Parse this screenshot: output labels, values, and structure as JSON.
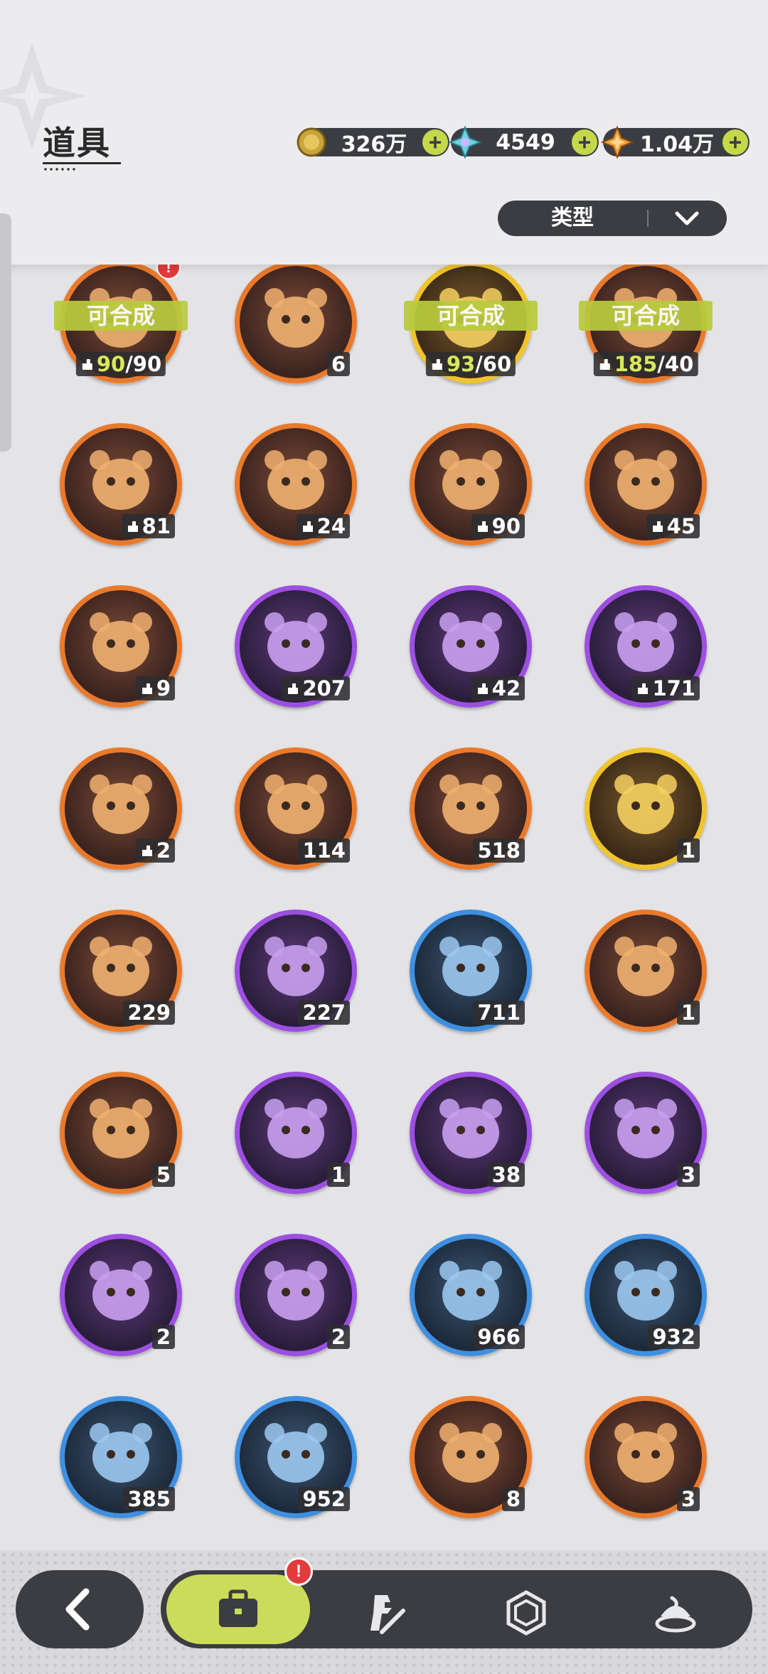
{
  "header": {
    "title": "道具",
    "filter": {
      "label": "类型"
    }
  },
  "currencies": [
    {
      "icon": "gold-coin-icon",
      "amount": "326万"
    },
    {
      "icon": "crystal-gem-icon",
      "amount": "4549"
    },
    {
      "icon": "star-shard-icon",
      "amount": "1.04万"
    }
  ],
  "craftable_label": "可合成",
  "items": [
    {
      "icon": "bear-doll-icon",
      "rarity": "orange",
      "type": "shard",
      "have": "90",
      "need": "/90",
      "craftable": true,
      "alert": "!"
    },
    {
      "icon": "purple-crystal-icon",
      "rarity": "orange",
      "type": "count",
      "count": "6"
    },
    {
      "icon": "bear-doll-icon",
      "rarity": "gold",
      "type": "shard",
      "have": "93",
      "need": "/60",
      "craftable": true
    },
    {
      "icon": "bear-doll-icon",
      "rarity": "orange",
      "type": "shard",
      "have": "185",
      "need": "/40",
      "craftable": true
    },
    {
      "icon": "brown-bear-icon",
      "rarity": "orange",
      "type": "shard",
      "count": "81"
    },
    {
      "icon": "knight-bear-icon",
      "rarity": "orange",
      "type": "shard",
      "count": "24"
    },
    {
      "icon": "white-bear-icon",
      "rarity": "orange",
      "type": "shard",
      "count": "90"
    },
    {
      "icon": "dark-bear-icon",
      "rarity": "orange",
      "type": "shard",
      "count": "45"
    },
    {
      "icon": "lavender-cat-icon",
      "rarity": "orange",
      "type": "shard",
      "count": "9"
    },
    {
      "icon": "green-frog-icon",
      "rarity": "purple",
      "type": "shard",
      "count": "207"
    },
    {
      "icon": "brown-pirate-bear-icon",
      "rarity": "purple",
      "type": "shard",
      "count": "42"
    },
    {
      "icon": "yellow-bird-icon",
      "rarity": "purple",
      "type": "shard",
      "count": "171"
    },
    {
      "icon": "tiger-cat-icon",
      "rarity": "orange",
      "type": "shard",
      "count": "2"
    },
    {
      "icon": "pink-star-crystal-icon",
      "rarity": "orange",
      "type": "count",
      "count": "114"
    },
    {
      "icon": "blue-star-crystal-icon",
      "rarity": "orange",
      "type": "count",
      "count": "518"
    },
    {
      "icon": "golden-card-icon",
      "rarity": "gold",
      "type": "count",
      "count": "1"
    },
    {
      "icon": "gold-character-card-icon",
      "rarity": "orange",
      "type": "count",
      "count": "229"
    },
    {
      "icon": "purple-character-card-icon",
      "rarity": "purple",
      "type": "count",
      "count": "227"
    },
    {
      "icon": "blue-character-card-icon",
      "rarity": "blue",
      "type": "count",
      "count": "711"
    },
    {
      "icon": "mystic-card-icon",
      "rarity": "orange",
      "type": "count",
      "count": "1"
    },
    {
      "icon": "clover-ticket-icon",
      "rarity": "orange",
      "type": "count",
      "count": "5"
    },
    {
      "icon": "chocolate-gift-icon",
      "rarity": "purple",
      "type": "count",
      "count": "1"
    },
    {
      "icon": "golden-bag-icon",
      "rarity": "purple",
      "type": "count",
      "count": "38"
    },
    {
      "icon": "magic-mirror-icon",
      "rarity": "purple",
      "type": "count",
      "count": "3"
    },
    {
      "icon": "scroll-icon",
      "rarity": "purple",
      "type": "count",
      "count": "2"
    },
    {
      "icon": "pink-apple-icon",
      "rarity": "purple",
      "type": "count",
      "count": "2"
    },
    {
      "icon": "shovel-icon",
      "rarity": "blue",
      "type": "count",
      "count": "966"
    },
    {
      "icon": "gauntlet-icon",
      "rarity": "blue",
      "type": "count",
      "count": "932"
    },
    {
      "icon": "pickaxe-icon",
      "rarity": "blue",
      "type": "count",
      "count": "385"
    },
    {
      "icon": "hammer-icon",
      "rarity": "blue",
      "type": "count",
      "count": "952"
    },
    {
      "icon": "green-cloud-icon",
      "rarity": "orange",
      "type": "count",
      "count": "8"
    },
    {
      "icon": "spiked-ball-icon",
      "rarity": "orange",
      "type": "count",
      "count": "3"
    }
  ],
  "bottom_nav": {
    "back": "back-arrow-icon",
    "tabs": [
      {
        "icon": "bag-icon",
        "active": true,
        "alert": "!"
      },
      {
        "icon": "knight-sword-icon",
        "active": false
      },
      {
        "icon": "hexagon-gem-icon",
        "active": false
      },
      {
        "icon": "dessert-icon",
        "active": false
      }
    ]
  }
}
